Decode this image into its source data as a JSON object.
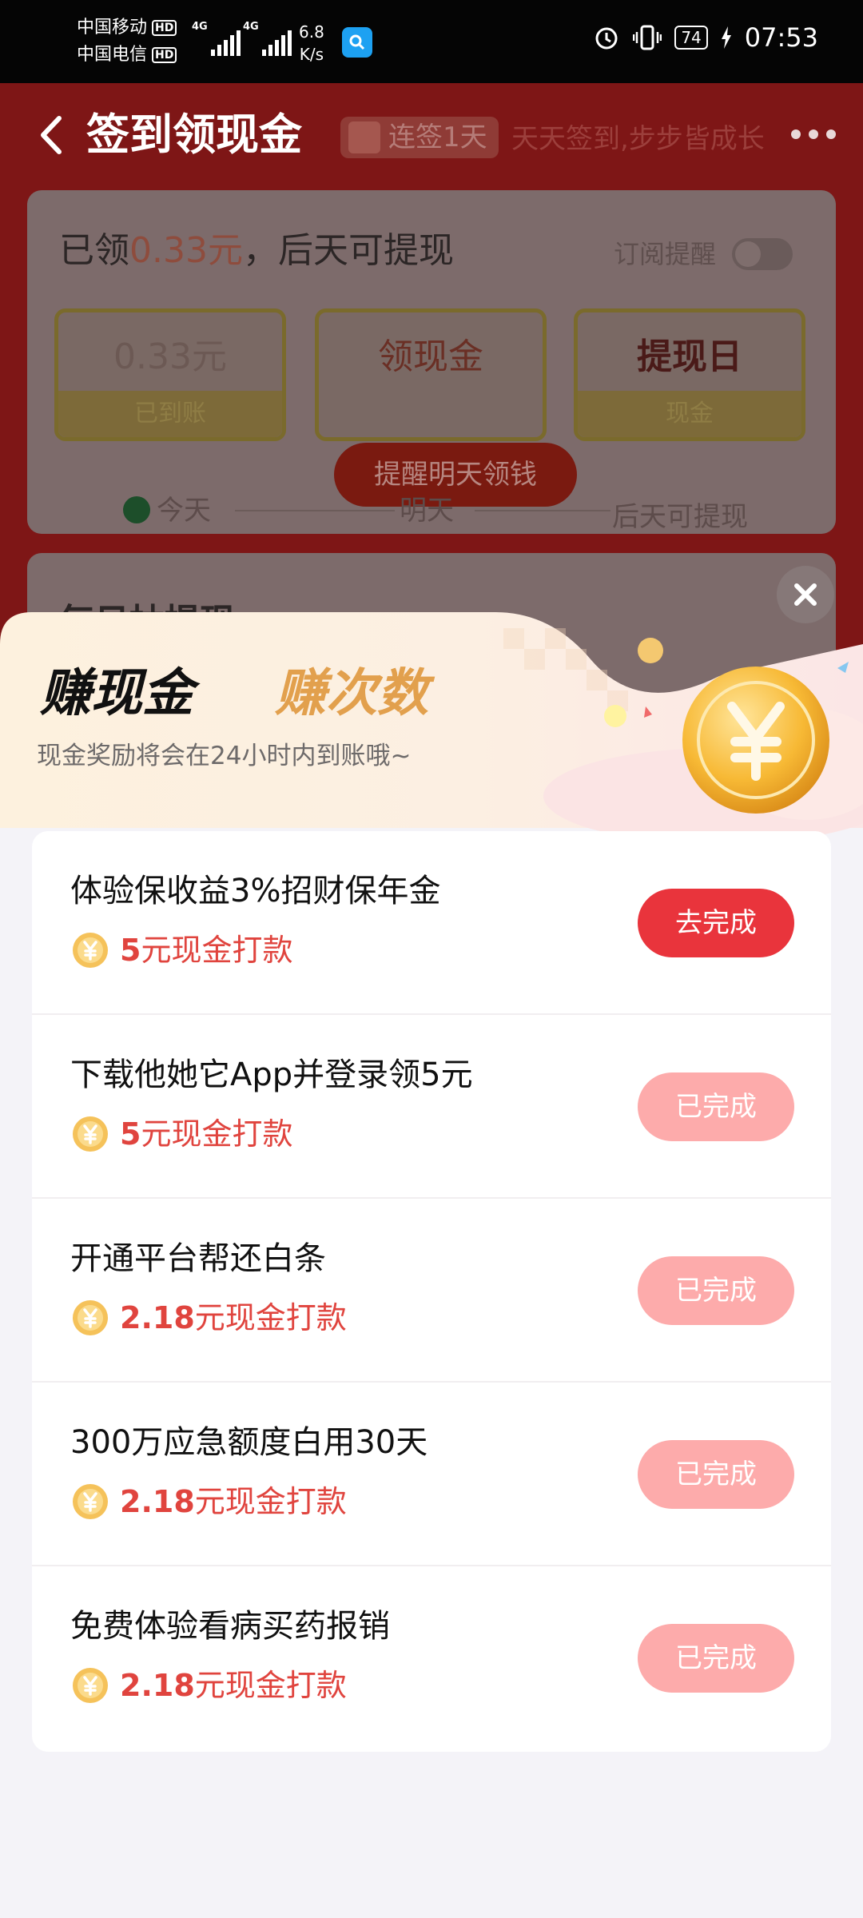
{
  "status_bar": {
    "carrier1": "中国移动",
    "carrier2": "中国电信",
    "hd": "HD",
    "net1": "4G",
    "net2": "4G",
    "speed_value": "6.8",
    "speed_unit": "K/s",
    "battery": "74",
    "time": "07:53",
    "icons": [
      "hd-icon",
      "signal-icon",
      "search-app-icon",
      "alarm-icon",
      "vibrate-icon",
      "battery-icon",
      "charging-icon"
    ]
  },
  "page": {
    "title": "签到领现金",
    "streak": "连签1天",
    "slogan": "天天签到,步步皆成长",
    "card": {
      "prefix": "已领",
      "amount": "0.33元",
      "suffix": "，后天可提现",
      "subscribe": "订阅提醒",
      "days": [
        {
          "top": "0.33元",
          "bottom": "已到账"
        },
        {
          "top": "领现金",
          "bottom": "提醒明天领钱"
        },
        {
          "top": "提现日",
          "bottom": "现金"
        }
      ],
      "timeline": [
        "今天",
        "明天",
        "后天可提现"
      ]
    },
    "section2_title": "每日抽提现"
  },
  "sheet": {
    "tab_active": "赚现金",
    "tab_inactive": "赚次数",
    "description": "现金奖励将会在24小时内到账哦~",
    "tasks": [
      {
        "title": "体验保收益3%招财保年金",
        "amount": "5",
        "unit_text": "元现金打款",
        "action": "去完成",
        "status": "todo"
      },
      {
        "title": "下载他她它App并登录领5元",
        "amount": "5",
        "unit_text": "元现金打款",
        "action": "已完成",
        "status": "done"
      },
      {
        "title": "开通平台帮还白条",
        "amount": "2.18",
        "unit_text": "元现金打款",
        "action": "已完成",
        "status": "done"
      },
      {
        "title": "300万应急额度白用30天",
        "amount": "2.18",
        "unit_text": "元现金打款",
        "action": "已完成",
        "status": "done"
      },
      {
        "title": "免费体验看病买药报销",
        "amount": "2.18",
        "unit_text": "元现金打款",
        "action": "已完成",
        "status": "done"
      }
    ]
  },
  "colors": {
    "primary_red": "#e9343c",
    "done_pink": "#fdabab",
    "reward_red": "#e0443e",
    "tab_orange": "#e2a04d"
  }
}
